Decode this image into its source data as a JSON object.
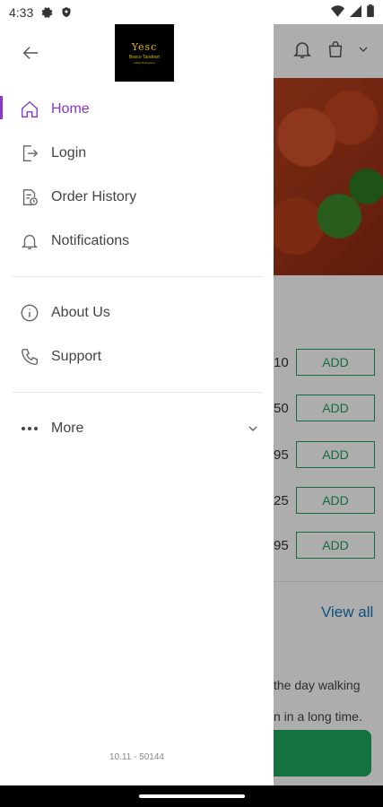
{
  "status_bar": {
    "time": "4:33"
  },
  "drawer": {
    "logo": {
      "line1": "Yesc",
      "line2": "Bosco Tandoori",
      "line3": "Indian Restaurant"
    },
    "menu_primary": [
      {
        "label": "Home",
        "icon": "home-icon",
        "active": true
      },
      {
        "label": "Login",
        "icon": "login-icon"
      },
      {
        "label": "Order History",
        "icon": "order-history-icon"
      },
      {
        "label": "Notifications",
        "icon": "bell-icon"
      }
    ],
    "menu_secondary": [
      {
        "label": "About Us",
        "icon": "info-icon"
      },
      {
        "label": "Support",
        "icon": "phone-icon"
      }
    ],
    "more": {
      "label": "More"
    },
    "version": "10.11 - 50144"
  },
  "background": {
    "prices": [
      "10",
      "50",
      "95",
      "25",
      "95"
    ],
    "add_label": "ADD",
    "view_all": "View all",
    "text_line1": "the day walking",
    "text_line2": "n in a long time."
  },
  "colors": {
    "accent": "#8a36c9",
    "green": "#1e9e5a",
    "link": "#1676b8"
  }
}
